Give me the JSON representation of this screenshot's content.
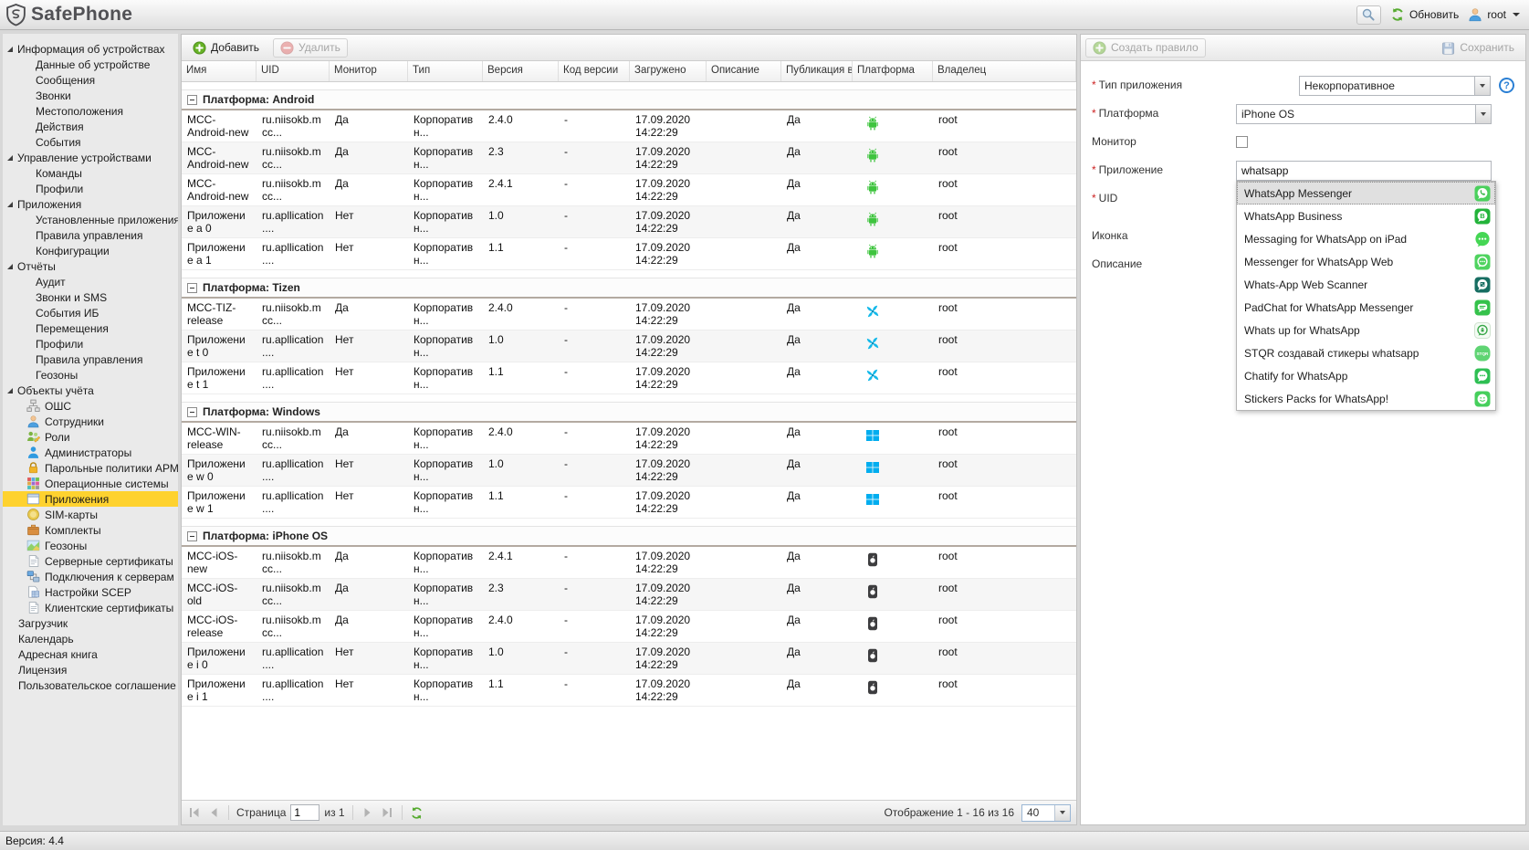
{
  "colors": {
    "selection_yellow": "#fed22f",
    "android_green": "#3ec43e",
    "tizen_cyan": "#14b9ea",
    "windows_blue": "#00adef",
    "iphone_dark": "#3d3d3f",
    "whatsapp_green": "#4ad05c",
    "button_green": "#67b226",
    "danger_red": "#dd5c5c"
  },
  "header": {
    "app_title": "SafePhone",
    "refresh_label": "Обновить",
    "user_label": "root"
  },
  "sidebar": {
    "tree": [
      {
        "label": "Информация об устройствах",
        "children": [
          {
            "label": "Данные об устройстве"
          },
          {
            "label": "Сообщения"
          },
          {
            "label": "Звонки"
          },
          {
            "label": "Местоположения"
          },
          {
            "label": "Действия"
          },
          {
            "label": "События"
          }
        ]
      },
      {
        "label": "Управление устройствами",
        "children": [
          {
            "label": "Команды"
          },
          {
            "label": "Профили"
          }
        ]
      },
      {
        "label": "Приложения",
        "children": [
          {
            "label": "Установленные приложения"
          },
          {
            "label": "Правила управления"
          },
          {
            "label": "Конфигурации"
          }
        ]
      },
      {
        "label": "Отчёты",
        "children": [
          {
            "label": "Аудит"
          },
          {
            "label": "Звонки и SMS"
          },
          {
            "label": "События ИБ"
          },
          {
            "label": "Перемещения"
          },
          {
            "label": "Профили"
          },
          {
            "label": "Правила управления"
          },
          {
            "label": "Геозоны"
          }
        ]
      },
      {
        "label": "Объекты учёта",
        "children": [
          {
            "label": "ОШС",
            "icon": "orgchart-icon"
          },
          {
            "label": "Сотрудники",
            "icon": "employees-icon"
          },
          {
            "label": "Роли",
            "icon": "roles-icon"
          },
          {
            "label": "Администраторы",
            "icon": "administrators-icon"
          },
          {
            "label": "Парольные политики АРМ",
            "icon": "password-policy-icon"
          },
          {
            "label": "Операционные системы",
            "icon": "os-icon"
          },
          {
            "label": "Приложения",
            "icon": "applications-icon",
            "selected": true
          },
          {
            "label": "SIM-карты",
            "icon": "sim-icon"
          },
          {
            "label": "Комплекты",
            "icon": "kits-icon"
          },
          {
            "label": "Геозоны",
            "icon": "geozones-icon"
          },
          {
            "label": "Серверные сертификаты",
            "icon": "server-cert-icon"
          },
          {
            "label": "Подключения к серверам",
            "icon": "connections-icon"
          },
          {
            "label": "Настройки SCEP",
            "icon": "scep-icon"
          },
          {
            "label": "Клиентские сертификаты",
            "icon": "client-cert-icon"
          }
        ]
      },
      {
        "label": "Загрузчик"
      },
      {
        "label": "Календарь"
      },
      {
        "label": "Адресная книга"
      },
      {
        "label": "Лицензия"
      },
      {
        "label": "Пользовательское соглашение"
      }
    ]
  },
  "apps_panel": {
    "toolbar": {
      "add_label": "Добавить",
      "delete_label": "Удалить"
    },
    "columns": [
      "Имя",
      "UID",
      "Монитор",
      "Тип",
      "Версия",
      "Код версии",
      "Загружено",
      "Описание",
      "Публикация в Ката",
      "Платформа",
      "Владелец"
    ],
    "groups": [
      {
        "label": "Платформа: Android",
        "platform_icon": "android-icon",
        "rows": [
          {
            "name": "MCC-Android-new",
            "uid": "ru.niisokb.mcc...",
            "monitor": "Да",
            "type": "Корпоративн...",
            "version": "2.4.0",
            "version_code": "-",
            "uploaded": "17.09.2020 14:22:29",
            "description": "",
            "publication": "Да",
            "owner": "root"
          },
          {
            "name": "MCC-Android-new",
            "uid": "ru.niisokb.mcc...",
            "monitor": "Да",
            "type": "Корпоративн...",
            "version": "2.3",
            "version_code": "-",
            "uploaded": "17.09.2020 14:22:29",
            "description": "",
            "publication": "Да",
            "owner": "root"
          },
          {
            "name": "MCC-Android-new",
            "uid": "ru.niisokb.mcc...",
            "monitor": "Да",
            "type": "Корпоративн...",
            "version": "2.4.1",
            "version_code": "-",
            "uploaded": "17.09.2020 14:22:29",
            "description": "",
            "publication": "Да",
            "owner": "root"
          },
          {
            "name": "Приложение a 0",
            "uid": "ru.apllication....",
            "monitor": "Нет",
            "type": "Корпоративн...",
            "version": "1.0",
            "version_code": "-",
            "uploaded": "17.09.2020 14:22:29",
            "description": "",
            "publication": "Да",
            "owner": "root"
          },
          {
            "name": "Приложение a 1",
            "uid": "ru.apllication....",
            "monitor": "Нет",
            "type": "Корпоративн...",
            "version": "1.1",
            "version_code": "-",
            "uploaded": "17.09.2020 14:22:29",
            "description": "",
            "publication": "Да",
            "owner": "root"
          }
        ]
      },
      {
        "label": "Платформа: Tizen",
        "platform_icon": "tizen-icon",
        "rows": [
          {
            "name": "MCC-TIZ-release",
            "uid": "ru.niisokb.mcc...",
            "monitor": "Да",
            "type": "Корпоративн...",
            "version": "2.4.0",
            "version_code": "-",
            "uploaded": "17.09.2020 14:22:29",
            "description": "",
            "publication": "Да",
            "owner": "root"
          },
          {
            "name": "Приложение t 0",
            "uid": "ru.apllication....",
            "monitor": "Нет",
            "type": "Корпоративн...",
            "version": "1.0",
            "version_code": "-",
            "uploaded": "17.09.2020 14:22:29",
            "description": "",
            "publication": "Да",
            "owner": "root"
          },
          {
            "name": "Приложение t 1",
            "uid": "ru.apllication....",
            "monitor": "Нет",
            "type": "Корпоративн...",
            "version": "1.1",
            "version_code": "-",
            "uploaded": "17.09.2020 14:22:29",
            "description": "",
            "publication": "Да",
            "owner": "root"
          }
        ]
      },
      {
        "label": "Платформа: Windows",
        "platform_icon": "windows-icon",
        "rows": [
          {
            "name": "MCC-WIN-release",
            "uid": "ru.niisokb.mcc...",
            "monitor": "Да",
            "type": "Корпоративн...",
            "version": "2.4.0",
            "version_code": "-",
            "uploaded": "17.09.2020 14:22:29",
            "description": "",
            "publication": "Да",
            "owner": "root"
          },
          {
            "name": "Приложение w 0",
            "uid": "ru.apllication....",
            "monitor": "Нет",
            "type": "Корпоративн...",
            "version": "1.0",
            "version_code": "-",
            "uploaded": "17.09.2020 14:22:29",
            "description": "",
            "publication": "Да",
            "owner": "root"
          },
          {
            "name": "Приложение w 1",
            "uid": "ru.apllication....",
            "monitor": "Нет",
            "type": "Корпоративн...",
            "version": "1.1",
            "version_code": "-",
            "uploaded": "17.09.2020 14:22:29",
            "description": "",
            "publication": "Да",
            "owner": "root"
          }
        ]
      },
      {
        "label": "Платформа: iPhone OS",
        "platform_icon": "iphone-icon",
        "rows": [
          {
            "name": "MCC-iOS-new",
            "uid": "ru.niisokb.mcc...",
            "monitor": "Да",
            "type": "Корпоративн...",
            "version": "2.4.1",
            "version_code": "-",
            "uploaded": "17.09.2020 14:22:29",
            "description": "",
            "publication": "Да",
            "owner": "root"
          },
          {
            "name": "MCC-iOS-old",
            "uid": "ru.niisokb.mcc...",
            "monitor": "Да",
            "type": "Корпоративн...",
            "version": "2.3",
            "version_code": "-",
            "uploaded": "17.09.2020 14:22:29",
            "description": "",
            "publication": "Да",
            "owner": "root"
          },
          {
            "name": "MCC-iOS-release",
            "uid": "ru.niisokb.mcc...",
            "monitor": "Да",
            "type": "Корпоративн...",
            "version": "2.4.0",
            "version_code": "-",
            "uploaded": "17.09.2020 14:22:29",
            "description": "",
            "publication": "Да",
            "owner": "root"
          },
          {
            "name": "Приложение i 0",
            "uid": "ru.apllication....",
            "monitor": "Нет",
            "type": "Корпоративн...",
            "version": "1.0",
            "version_code": "-",
            "uploaded": "17.09.2020 14:22:29",
            "description": "",
            "publication": "Да",
            "owner": "root"
          },
          {
            "name": "Приложение i 1",
            "uid": "ru.apllication....",
            "monitor": "Нет",
            "type": "Корпоративн...",
            "version": "1.1",
            "version_code": "-",
            "uploaded": "17.09.2020 14:22:29",
            "description": "",
            "publication": "Да",
            "owner": "root"
          }
        ]
      }
    ],
    "pagination": {
      "page_label": "Страница",
      "page_value": "1",
      "of_label": "из 1",
      "display_text": "Отображение 1 - 16 из 16",
      "page_size": "40"
    }
  },
  "rule_panel": {
    "toolbar": {
      "create_label": "Создать правило",
      "save_label": "Сохранить"
    },
    "fields": [
      {
        "label": "Тип приложения",
        "required": true,
        "control": "select",
        "value": "Некорпоративное",
        "help": true
      },
      {
        "label": "Платформа",
        "required": true,
        "control": "select",
        "value": "iPhone OS"
      },
      {
        "label": "Монитор",
        "control": "checkbox",
        "checked": false
      },
      {
        "label": "Приложение",
        "required": true,
        "control": "text",
        "value": "whatsapp"
      },
      {
        "label": "UID",
        "required": true,
        "control": "text",
        "value": ""
      },
      {
        "label": "Иконка",
        "control": "none"
      },
      {
        "label": "Описание",
        "control": "none"
      }
    ],
    "suggestions": [
      {
        "label": "WhatsApp Messenger",
        "icon": "whatsapp-messenger-icon",
        "selected": true
      },
      {
        "label": "WhatsApp Business",
        "icon": "whatsapp-business-icon"
      },
      {
        "label": "Messaging for WhatsApp on iPad",
        "icon": "messaging-ipad-icon"
      },
      {
        "label": "Messenger for WhatsApp Web",
        "icon": "messenger-web-icon"
      },
      {
        "label": "Whats-App Web Scanner",
        "icon": "web-scanner-icon"
      },
      {
        "label": "PadChat for WhatsApp Messenger",
        "icon": "padchat-icon"
      },
      {
        "label": "Whats up for WhatsApp",
        "icon": "whatsup-icon"
      },
      {
        "label": "STQR создавай стикеры whatsapp",
        "icon": "stqr-icon"
      },
      {
        "label": "Chatify for WhatsApp",
        "icon": "chatify-icon"
      },
      {
        "label": "Stickers Packs for WhatsApp!",
        "icon": "stickers-packs-icon"
      }
    ]
  },
  "statusbar": {
    "version_text": "Версия: 4.4"
  }
}
